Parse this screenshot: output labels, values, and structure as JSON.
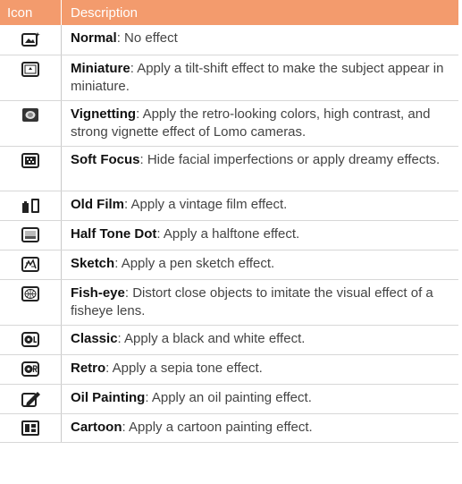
{
  "header": {
    "icon": "Icon",
    "description": "Description"
  },
  "rows": [
    {
      "icon": "normal-effect-icon",
      "name": "Normal",
      "text": ": No effect"
    },
    {
      "icon": "miniature-effect-icon",
      "name": "Miniature",
      "text": ": Apply a tilt-shift effect to make the subject appear in miniature."
    },
    {
      "icon": "vignetting-effect-icon",
      "name": "Vignetting",
      "text": ": Apply the retro-looking colors, high contrast, and strong vignette effect of Lomo cameras."
    },
    {
      "icon": "soft-focus-effect-icon",
      "name": "Soft Focus",
      "text": ": Hide facial imperfections or apply dreamy effects."
    },
    {
      "icon": "old-film-effect-icon",
      "name": "Old Film",
      "text": ": Apply a vintage film effect."
    },
    {
      "icon": "half-tone-dot-effect-icon",
      "name": "Half Tone Dot",
      "text": ": Apply a halftone effect."
    },
    {
      "icon": "sketch-effect-icon",
      "name": "Sketch",
      "text": ": Apply a pen sketch effect."
    },
    {
      "icon": "fish-eye-effect-icon",
      "name": "Fish-eye",
      "text": ": Distort close objects to imitate the visual effect of a fisheye lens."
    },
    {
      "icon": "classic-effect-icon",
      "name": "Classic",
      "text": ": Apply a black and white effect."
    },
    {
      "icon": "retro-effect-icon",
      "name": "Retro",
      "text": ": Apply a sepia tone effect."
    },
    {
      "icon": "oil-painting-effect-icon",
      "name": "Oil Painting",
      "text": ": Apply an oil painting effect."
    },
    {
      "icon": "cartoon-effect-icon",
      "name": "Cartoon",
      "text": ": Apply a cartoon painting effect."
    }
  ],
  "colors": {
    "header_bg": "#f39b6d",
    "header_text": "#ffffff",
    "rule": "#d7d7d7"
  }
}
